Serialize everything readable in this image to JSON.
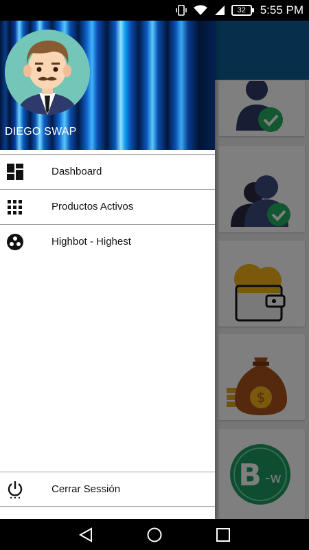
{
  "status_bar": {
    "time": "5:55 PM",
    "battery": "32",
    "icons": [
      "vibrate-icon",
      "wifi-icon",
      "signal-icon",
      "battery-icon"
    ]
  },
  "drawer": {
    "user_name": "DIEGO SWAP",
    "menu": [
      {
        "label": "Dashboard",
        "icon": "dashboard-icon"
      },
      {
        "label": "Productos Activos",
        "icon": "grid-icon"
      },
      {
        "label": "Highbot - Highest",
        "icon": "bot-icon"
      }
    ],
    "footer": {
      "label": "Cerrar Sessión",
      "icon": "power-icon"
    }
  },
  "background_app": {
    "cards": [
      "user-verified-icon",
      "users-verified-icon",
      "wallet-icon",
      "money-bag-icon",
      "bw-coin-icon"
    ],
    "colors": {
      "toolbar": "#0a5f96",
      "coin": "#1f9b62"
    }
  },
  "nav_bar": {
    "buttons": [
      "back-icon",
      "home-icon",
      "recents-icon"
    ]
  }
}
